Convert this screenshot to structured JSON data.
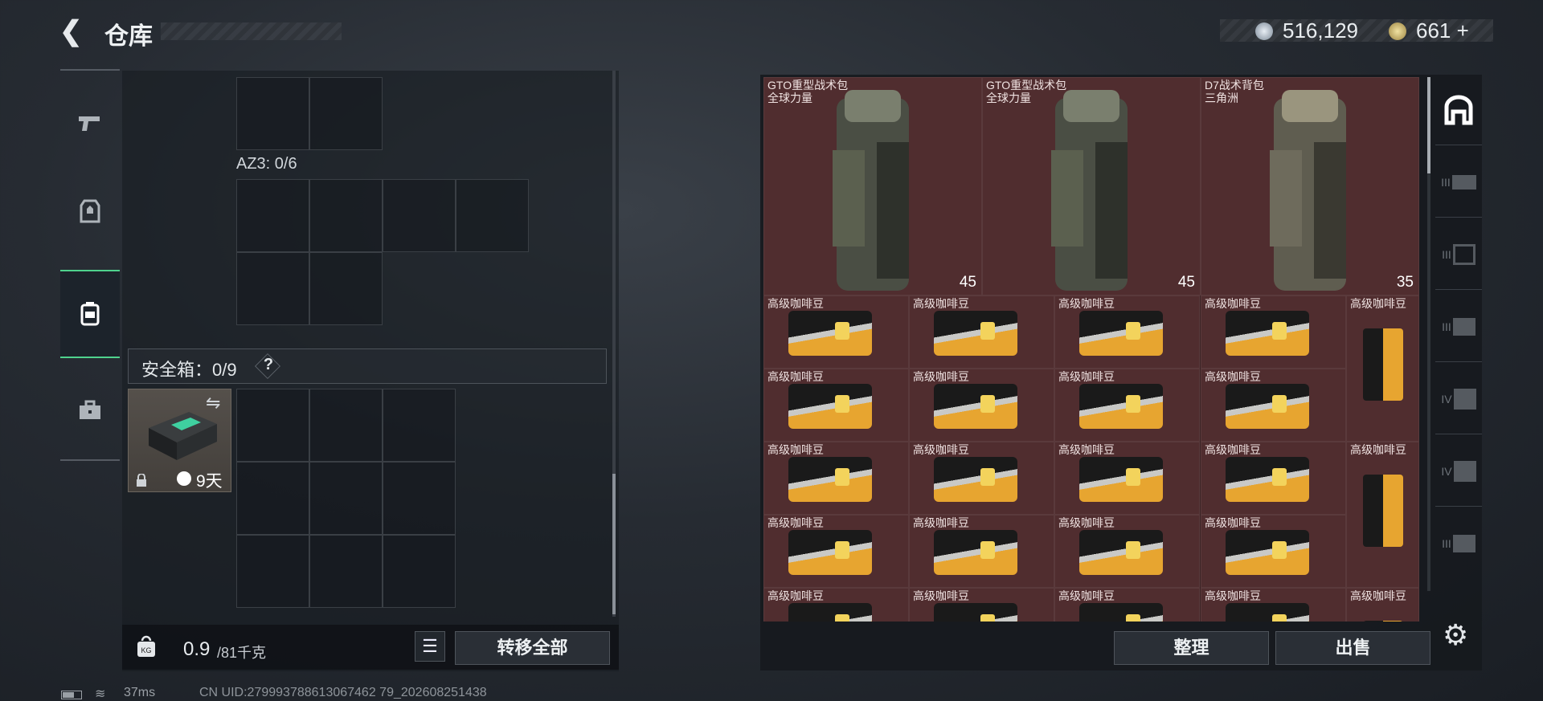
{
  "header": {
    "back_icon": "back-arrow-icon",
    "title": "仓库"
  },
  "currency": {
    "silver": "516,129",
    "gold": "661",
    "gold_add": "+"
  },
  "tabs": [
    {
      "icon": "pistol-icon",
      "active": false
    },
    {
      "icon": "armor-vest-icon",
      "active": false
    },
    {
      "icon": "backpack-icon",
      "active": true
    },
    {
      "icon": "toolbox-icon",
      "active": false
    }
  ],
  "left": {
    "az3_label": "AZ3: 0/6",
    "safe_label": "安全箱：0/9",
    "safe_help": "?",
    "safe_item_days": "9天",
    "weight_value": "0.9",
    "weight_unit": "/81千克",
    "transfer_all": "转移全部"
  },
  "stash": {
    "backpacks": [
      {
        "name": "GTO重型战术包\n全球力量",
        "qty": "45"
      },
      {
        "name": "GTO重型战术包\n全球力量",
        "qty": "45"
      },
      {
        "name": "D7战术背包\n三角洲",
        "qty": "35"
      }
    ],
    "coffee_name": "高级咖啡豆"
  },
  "right": {
    "sort": "整理",
    "sell": "出售"
  },
  "sidebar": {
    "labels": [
      "",
      "III",
      "III",
      "III",
      "IV",
      "IV",
      "III"
    ]
  },
  "status": {
    "ping": "37ms",
    "uid": "CN UID:279993788613067462 79_202608251438"
  },
  "colors": {
    "slot_bg": "#502d2f",
    "accent_green": "#4fd28d"
  }
}
